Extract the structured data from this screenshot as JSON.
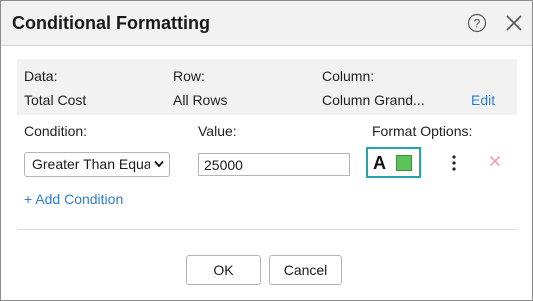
{
  "dialog": {
    "title": "Conditional Formatting",
    "help_icon": "question-circle-icon",
    "close_icon": "close-icon"
  },
  "summary": {
    "data_label": "Data:",
    "data_value": "Total Cost",
    "row_label": "Row:",
    "row_value": "All Rows",
    "column_label": "Column:",
    "column_value": "Column Grand...",
    "edit_label": "Edit"
  },
  "condition": {
    "label": "Condition:",
    "selected": "Greater Than Equal",
    "value_label": "Value:",
    "value": "25000",
    "format_label": "Format Options:",
    "format_text_glyph": "A",
    "format_fill_color": "#5cc35a",
    "accent_color": "#27a3b0",
    "remove_icon": "close-icon",
    "menu_icon": "vertical-dots-icon"
  },
  "add_condition_label": "+ Add Condition",
  "buttons": {
    "ok": "OK",
    "cancel": "Cancel"
  }
}
